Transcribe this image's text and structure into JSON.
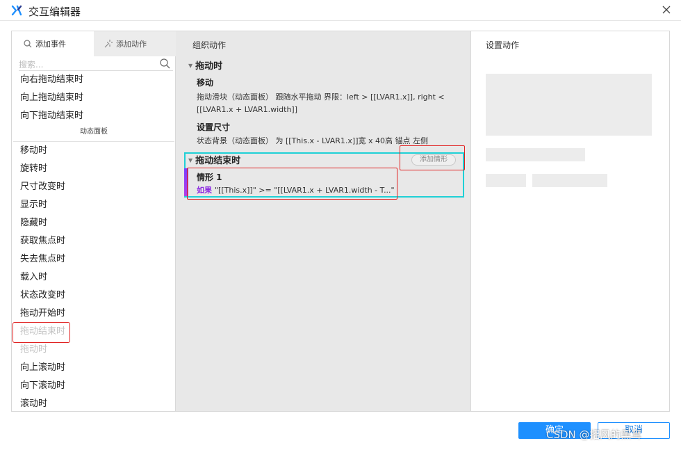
{
  "window": {
    "title": "交互编辑器"
  },
  "left": {
    "tabs": [
      {
        "label": "添加事件"
      },
      {
        "label": "添加动作"
      }
    ],
    "search": {
      "placeholder": "搜索..."
    },
    "events_top": [
      "向右拖动结束时",
      "向上拖动结束时",
      "向下拖动结束时"
    ],
    "section_label": "动态面板",
    "events": [
      {
        "label": "移动时"
      },
      {
        "label": "旋转时"
      },
      {
        "label": "尺寸改变时"
      },
      {
        "label": "显示时"
      },
      {
        "label": "隐藏时"
      },
      {
        "label": "获取焦点时"
      },
      {
        "label": "失去焦点时"
      },
      {
        "label": "载入时"
      },
      {
        "label": "状态改变时"
      },
      {
        "label": "拖动开始时"
      },
      {
        "label": "拖动结束时"
      },
      {
        "label": "拖动时"
      },
      {
        "label": "向上滚动时"
      },
      {
        "label": "向下滚动时"
      },
      {
        "label": "滚动时"
      }
    ]
  },
  "middle": {
    "title": "组织动作",
    "group1": {
      "label": "拖动时",
      "action1_name": "移动",
      "action1_desc": "拖动滑块（动态面板） 跟随水平拖动 界限：left > [[LVAR1.x]], right < [[LVAR1.x + LVAR1.width]]",
      "action2_name": "设置尺寸",
      "action2_desc": "状态背景（动态面板） 为 [[This.x - LVAR1.x]]宽 x 40高 锚点 左侧"
    },
    "group2": {
      "label": "拖动结束时",
      "add_case": "添加情形",
      "case_title": "情形 1",
      "case_keyword": "如果",
      "case_condition": "\"[[This.x]]\" >= \"[[LVAR1.x + LVAR1.width - T...\""
    }
  },
  "right": {
    "title": "设置动作"
  },
  "footer": {
    "ok": "确定",
    "cancel": "取消"
  },
  "watermark": "CSDN @招风的黑耳",
  "colors": {
    "accent": "#1e90ff",
    "highlight_teal": "#1fd0d6",
    "highlight_red": "#e02020",
    "case_bar": "#8d2be2"
  }
}
